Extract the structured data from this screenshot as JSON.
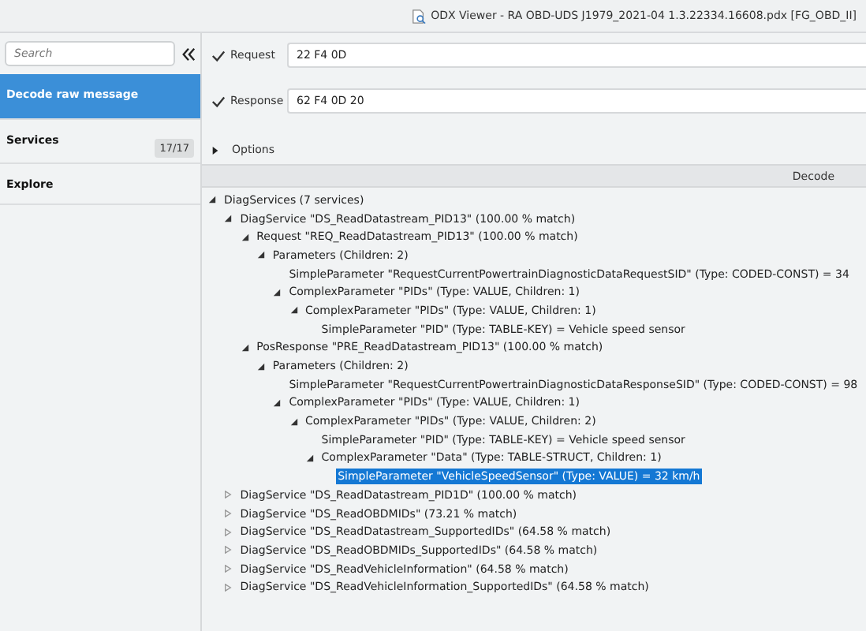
{
  "window": {
    "title": "ODX Viewer - RA OBD-UDS J1979_2021-04 1.3.22334.16608.pdx [FG_OBD_II]"
  },
  "sidebar": {
    "search": {
      "placeholder": "Search"
    },
    "items": [
      {
        "label": "Decode raw message",
        "selected": true
      },
      {
        "label": "Services",
        "badge": "17/17",
        "selected": false
      },
      {
        "label": "Explore",
        "selected": false
      }
    ]
  },
  "messages": [
    {
      "label": "Request",
      "checked": true,
      "value": "22 F4 0D"
    },
    {
      "label": "Response",
      "checked": true,
      "value": "62 F4 0D 20"
    }
  ],
  "options": {
    "label": "Options",
    "expanded": false
  },
  "decode_header": "Decode",
  "tree": [
    {
      "label": "DiagServices (7 services)",
      "expanded": true,
      "selected": false,
      "children": [
        {
          "label": "DiagService \"DS_ReadDatastream_PID13\" (100.00 % match)",
          "expanded": true,
          "selected": false,
          "children": [
            {
              "label": "Request \"REQ_ReadDatastream_PID13\" (100.00 % match)",
              "expanded": true,
              "selected": false,
              "children": [
                {
                  "label": "Parameters (Children: 2)",
                  "expanded": true,
                  "selected": false,
                  "children": [
                    {
                      "label": "SimpleParameter \"RequestCurrentPowertrainDiagnosticDataRequestSID\" (Type: CODED-CONST) = 34",
                      "selected": false
                    },
                    {
                      "label": "ComplexParameter \"PIDs\" (Type: VALUE, Children: 1)",
                      "expanded": true,
                      "selected": false,
                      "children": [
                        {
                          "label": "ComplexParameter \"PIDs\" (Type: VALUE, Children: 1)",
                          "expanded": true,
                          "selected": false,
                          "children": [
                            {
                              "label": "SimpleParameter \"PID\" (Type: TABLE-KEY) = Vehicle speed sensor",
                              "selected": false
                            }
                          ]
                        }
                      ]
                    }
                  ]
                }
              ]
            },
            {
              "label": "PosResponse \"PRE_ReadDatastream_PID13\" (100.00 % match)",
              "expanded": true,
              "selected": false,
              "children": [
                {
                  "label": "Parameters (Children: 2)",
                  "expanded": true,
                  "selected": false,
                  "children": [
                    {
                      "label": "SimpleParameter \"RequestCurrentPowertrainDiagnosticDataResponseSID\" (Type: CODED-CONST) = 98",
                      "selected": false
                    },
                    {
                      "label": "ComplexParameter \"PIDs\" (Type: VALUE, Children: 1)",
                      "expanded": true,
                      "selected": false,
                      "children": [
                        {
                          "label": "ComplexParameter \"PIDs\" (Type: VALUE, Children: 2)",
                          "expanded": true,
                          "selected": false,
                          "children": [
                            {
                              "label": "SimpleParameter \"PID\" (Type: TABLE-KEY) = Vehicle speed sensor",
                              "selected": false
                            },
                            {
                              "label": "ComplexParameter \"Data\" (Type: TABLE-STRUCT, Children: 1)",
                              "expanded": true,
                              "selected": false,
                              "children": [
                                {
                                  "label": "SimpleParameter \"VehicleSpeedSensor\" (Type: VALUE) = 32 km/h",
                                  "selected": true
                                }
                              ]
                            }
                          ]
                        }
                      ]
                    }
                  ]
                }
              ]
            }
          ]
        },
        {
          "label": "DiagService \"DS_ReadDatastream_PID1D\" (100.00 % match)",
          "expanded": false,
          "selected": false
        },
        {
          "label": "DiagService \"DS_ReadOBDMIDs\" (73.21 % match)",
          "expanded": false,
          "selected": false
        },
        {
          "label": "DiagService \"DS_ReadDatastream_SupportedIDs\" (64.58 % match)",
          "expanded": false,
          "selected": false
        },
        {
          "label": "DiagService \"DS_ReadOBDMIDs_SupportedIDs\" (64.58 % match)",
          "expanded": false,
          "selected": false
        },
        {
          "label": "DiagService \"DS_ReadVehicleInformation\" (64.58 % match)",
          "expanded": false,
          "selected": false
        },
        {
          "label": "DiagService \"DS_ReadVehicleInformation_SupportedIDs\" (64.58 % match)",
          "expanded": false,
          "selected": false
        }
      ]
    }
  ]
}
